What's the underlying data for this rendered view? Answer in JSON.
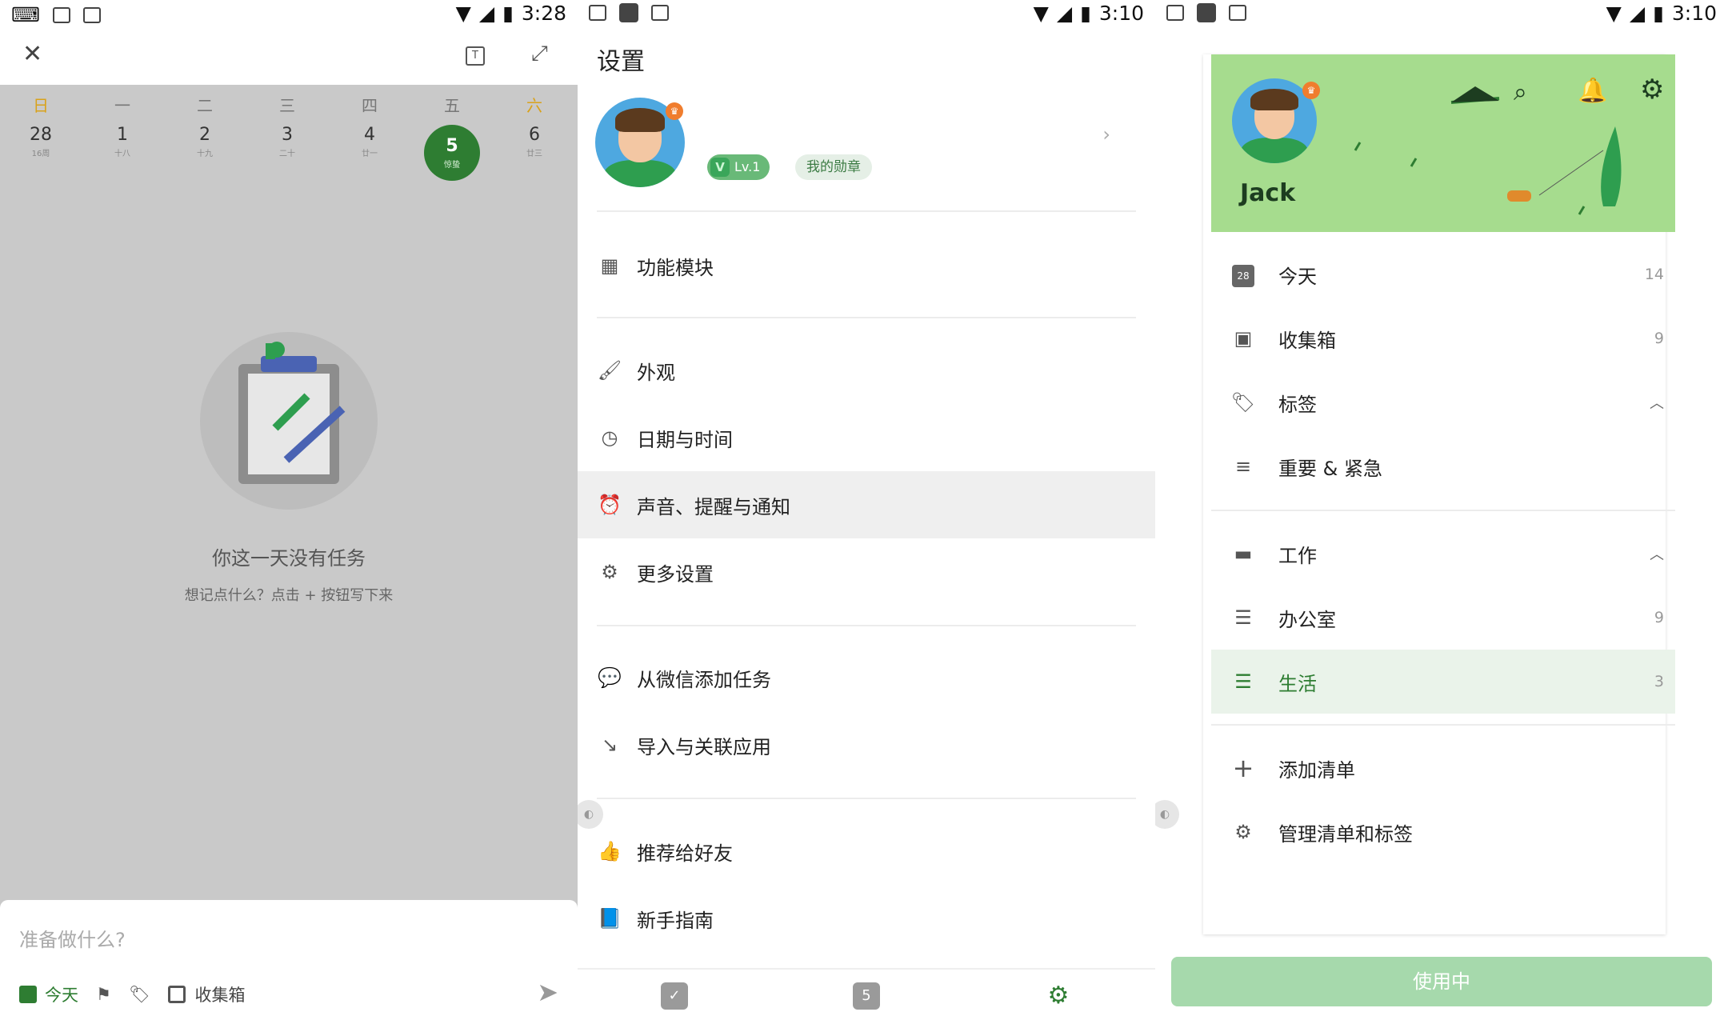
{
  "status_bars": [
    {
      "time": "3:28"
    },
    {
      "time": "3:10"
    },
    {
      "time": "3:10"
    }
  ],
  "panel1": {
    "weekdays": [
      "日",
      "一",
      "二",
      "三",
      "四",
      "五",
      "六"
    ],
    "days": [
      {
        "n": "28",
        "sub": "16周",
        "selected": false
      },
      {
        "n": "1",
        "sub": "十八",
        "selected": false
      },
      {
        "n": "2",
        "sub": "十九",
        "selected": false
      },
      {
        "n": "3",
        "sub": "二十",
        "selected": false
      },
      {
        "n": "4",
        "sub": "廿一",
        "selected": false
      },
      {
        "n": "5",
        "sub": "惊蛰",
        "selected": true
      },
      {
        "n": "6",
        "sub": "廿三",
        "selected": false
      }
    ],
    "empty_title": "你这一天没有任务",
    "empty_sub": "想记点什么？点击 + 按钮写下来",
    "quick_placeholder": "准备做什么?",
    "quick_today": "今天",
    "quick_inbox": "收集箱"
  },
  "panel2": {
    "title": "设置",
    "level": "Lv.1",
    "level_badge": "V",
    "badge": "我的勋章",
    "items": [
      {
        "label": "功能模块",
        "icon": "apps-icon"
      },
      {
        "label": "外观",
        "icon": "paint-roller-icon"
      },
      {
        "label": "日期与时间",
        "icon": "clock-icon"
      },
      {
        "label": "声音、提醒与通知",
        "icon": "alarm-icon"
      },
      {
        "label": "更多设置",
        "icon": "gear-icon"
      },
      {
        "label": "从微信添加任务",
        "icon": "wechat-icon"
      },
      {
        "label": "导入与关联应用",
        "icon": "import-arrow-icon"
      },
      {
        "label": "推荐给好友",
        "icon": "thumbs-up-icon"
      },
      {
        "label": "新手指南",
        "icon": "book-icon"
      }
    ],
    "nav_calendar_day": "5"
  },
  "panel3": {
    "user_name": "Jack",
    "items": [
      {
        "label": "今天",
        "count": "14",
        "icon": "calendar-icon",
        "icon_text": "28"
      },
      {
        "label": "收集箱",
        "count": "9",
        "icon": "inbox-icon"
      },
      {
        "label": "标签",
        "count": "",
        "icon": "tag-icon"
      },
      {
        "label": "重要 & 紧急",
        "count": "",
        "icon": "filter-icon"
      },
      {
        "label": "工作",
        "count": "",
        "icon": "folder-icon"
      },
      {
        "label": "办公室",
        "count": "9",
        "icon": "list-icon"
      },
      {
        "label": "生活",
        "count": "3",
        "icon": "menu-icon"
      },
      {
        "label": "添加清单",
        "count": "",
        "icon": "plus-icon"
      },
      {
        "label": "管理清单和标签",
        "count": "",
        "icon": "manage-gear-icon"
      }
    ],
    "in_use": "使用中"
  },
  "colors": {
    "primary_green": "#2e7d32",
    "overlay_gray": "#c9c9c9",
    "selected_row": "#efefef"
  }
}
